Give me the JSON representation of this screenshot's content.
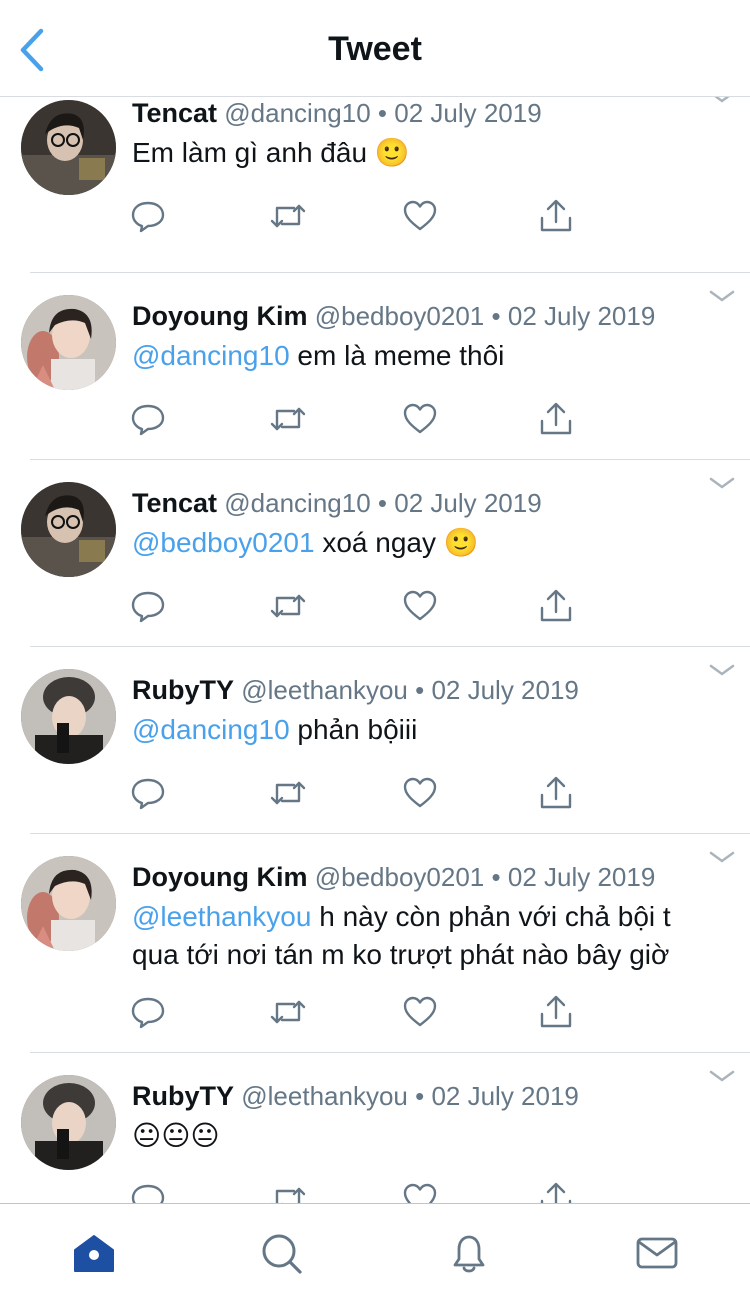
{
  "header": {
    "title": "Tweet"
  },
  "tweets": [
    {
      "username": "Tencat",
      "handle": "@dancing10",
      "separator": "•",
      "date": "02 July 2019",
      "mention": "",
      "text": "Em làm gì anh đâu ",
      "emoji": "🙂"
    },
    {
      "username": "Doyoung Kim",
      "handle": "@bedboy0201",
      "separator": "•",
      "date": "02 July 2019",
      "mention": "@dancing10",
      "text": " em là meme thôi",
      "emoji": ""
    },
    {
      "username": "Tencat",
      "handle": "@dancing10",
      "separator": "•",
      "date": "02 July 2019",
      "mention": "@bedboy0201",
      "text": " xoá ngay ",
      "emoji": "🙂"
    },
    {
      "username": "RubyTY",
      "handle": "@leethankyou",
      "separator": "•",
      "date": "02 July 2019",
      "mention": "@dancing10",
      "text": " phản bộiii",
      "emoji": ""
    },
    {
      "username": "Doyoung Kim",
      "handle": "@bedboy0201",
      "separator": "•",
      "date": "02 July 2019",
      "mention": "@leethankyou",
      "text": " h này còn phản với chả bội t qua tới nơi tán m ko trượt phát nào bây giờ",
      "emoji": ""
    },
    {
      "username": "RubyTY",
      "handle": "@leethankyou",
      "separator": "•",
      "date": "02 July 2019",
      "mention": "",
      "text": "",
      "emoji": "😐😐😐"
    }
  ],
  "icons": {
    "back": "chevron-left-icon",
    "more": "chevron-down-icon",
    "reply": "reply-icon",
    "retweet": "retweet-icon",
    "like": "heart-icon",
    "share": "share-icon",
    "home": "home-icon",
    "search": "search-icon",
    "notifications": "bell-icon",
    "messages": "mail-icon"
  },
  "colors": {
    "accent": "#4aa1eb",
    "active_tab": "#1d4fa3",
    "icon_gray": "#657786",
    "text": "#0f1419"
  }
}
